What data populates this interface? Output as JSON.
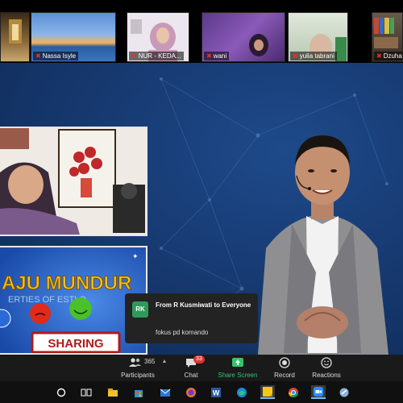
{
  "gallery": {
    "participants": [
      {
        "name": "",
        "muted": false
      },
      {
        "name": "Nassa Isyle",
        "muted": true
      },
      {
        "name": "NUR - KEDA...",
        "muted": true
      },
      {
        "name": "wani",
        "muted": true
      },
      {
        "name": "yulia tabrani",
        "muted": true
      },
      {
        "name": "Dzuha...",
        "muted": true
      }
    ]
  },
  "slide": {
    "title": "AJU MUNDUR",
    "subtitle": "ERTIES OF ESTLO",
    "button": "SHARING"
  },
  "chat_popup": {
    "avatar": "RK",
    "from": "From R Kusmiwati to Everyone",
    "message": "fokus pd komando"
  },
  "toolbar": {
    "participants_count": "365",
    "participants_label": "Participants",
    "chat_badge": "33",
    "chat_label": "Chat",
    "share_label": "Share Screen",
    "record_label": "Record",
    "reactions_label": "Reactions"
  },
  "taskbar": {
    "icons": [
      "search-circle-icon",
      "task-view-icon",
      "file-explorer-icon",
      "mail-icon",
      "firefox-icon",
      "word-icon",
      "edge-icon",
      "sticky-notes-icon",
      "chrome-icon",
      "zoom-icon",
      "app-icon"
    ]
  },
  "colors": {
    "background_blue": "#173a72",
    "share_green": "#36c46b",
    "badge_red": "#e0332f",
    "mic_red": "#e0332f"
  }
}
